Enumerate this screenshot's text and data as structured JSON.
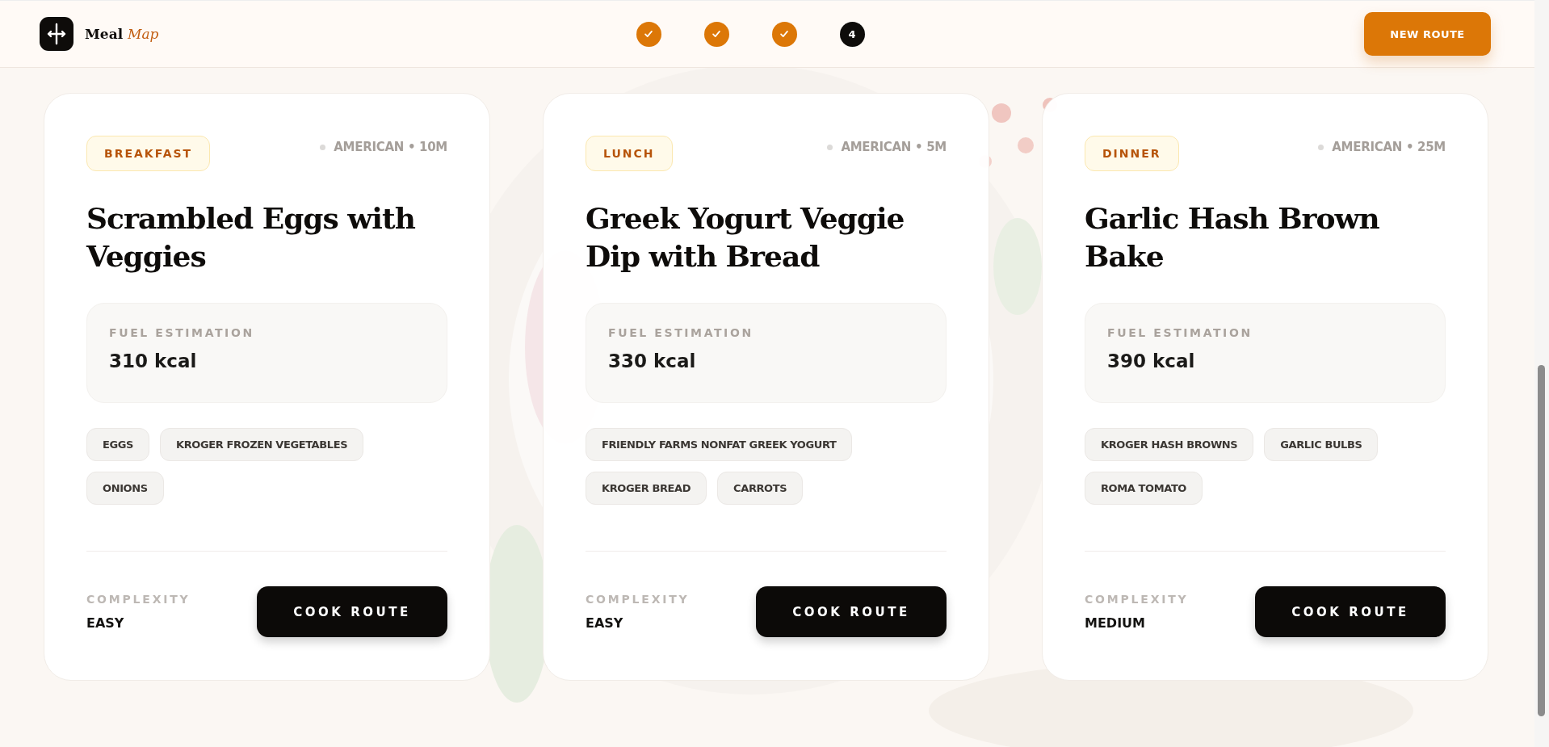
{
  "header": {
    "brand": {
      "name": "Meal",
      "accent": "Map"
    },
    "steps": [
      {
        "done": true
      },
      {
        "done": true
      },
      {
        "done": true
      },
      {
        "done": false,
        "label": "4"
      }
    ],
    "new_route_button": "NEW ROUTE"
  },
  "cards": [
    {
      "meal_tag": "BREAKFAST",
      "meta": "AMERICAN • 10M",
      "title": "Scrambled Eggs with Veggies",
      "fuel_label": "FUEL ESTIMATION",
      "fuel_value": "310 kcal",
      "ingredients": [
        "EGGS",
        "KROGER FROZEN VEGETABLES",
        "ONIONS"
      ],
      "complexity_label": "COMPLEXITY",
      "complexity": "EASY",
      "button": "COOK ROUTE"
    },
    {
      "meal_tag": "LUNCH",
      "meta": "AMERICAN • 5M",
      "title": "Greek Yogurt Veggie Dip with Bread",
      "fuel_label": "FUEL ESTIMATION",
      "fuel_value": "330 kcal",
      "ingredients": [
        "FRIENDLY FARMS NONFAT GREEK YOGURT",
        "KROGER BREAD",
        "CARROTS"
      ],
      "complexity_label": "COMPLEXITY",
      "complexity": "EASY",
      "button": "COOK ROUTE"
    },
    {
      "meal_tag": "DINNER",
      "meta": "AMERICAN • 25M",
      "title": "Garlic Hash Brown Bake",
      "fuel_label": "FUEL ESTIMATION",
      "fuel_value": "390 kcal",
      "ingredients": [
        "KROGER HASH BROWNS",
        "GARLIC BULBS",
        "ROMA TOMATO"
      ],
      "complexity_label": "COMPLEXITY",
      "complexity": "MEDIUM",
      "button": "COOK ROUTE"
    }
  ]
}
